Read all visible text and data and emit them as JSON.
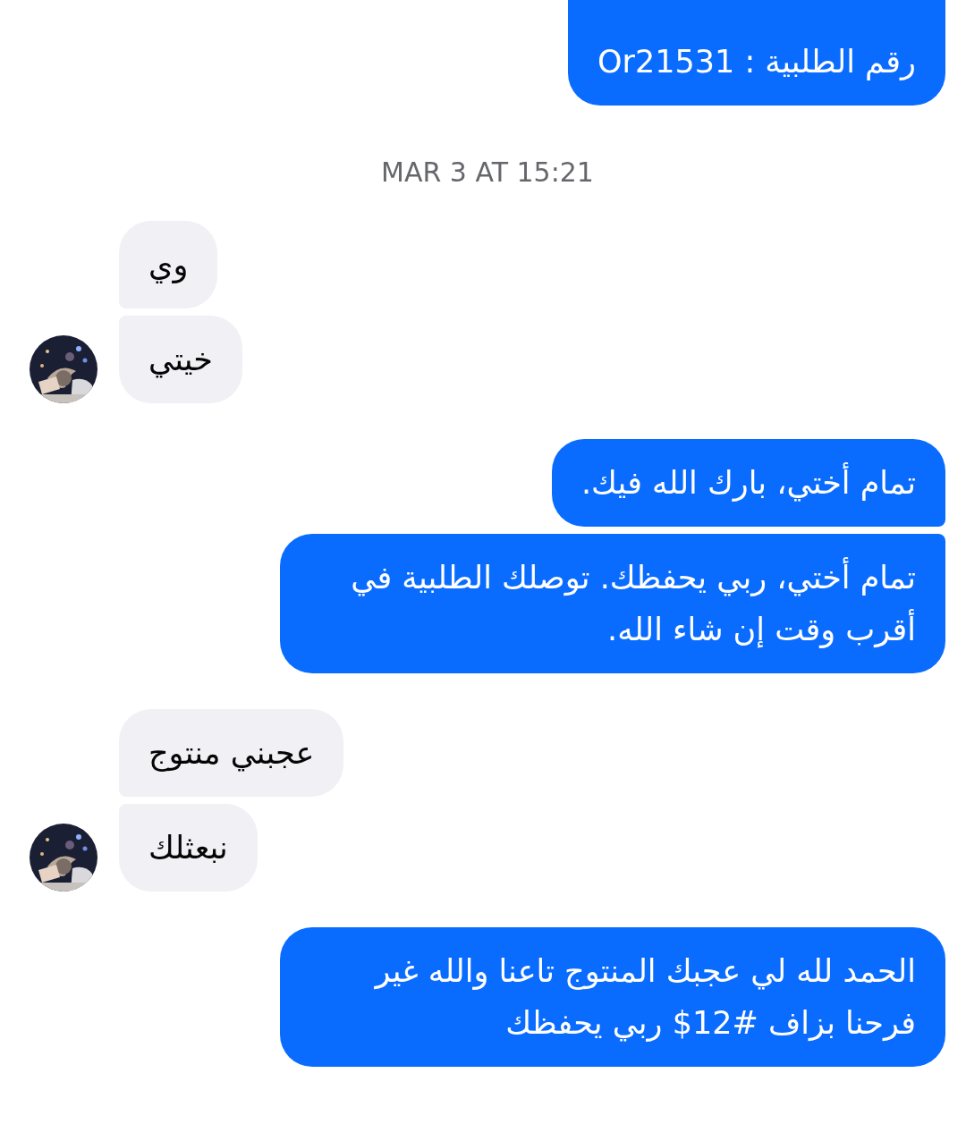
{
  "messages": [
    {
      "kind": "sent",
      "text": "رقم الطلبية : Or21531"
    },
    {
      "kind": "timestamp",
      "text": "MAR 3 AT 15:21"
    },
    {
      "kind": "received",
      "text": "وي",
      "avatar": false
    },
    {
      "kind": "received",
      "text": "خيتي",
      "avatar": true
    },
    {
      "kind": "sent",
      "text": "تمام أختي، بارك الله فيك."
    },
    {
      "kind": "sent",
      "text": "تمام أختي، ربي يحفظك. توصلك الطلبية في أقرب وقت إن شاء الله."
    },
    {
      "kind": "received",
      "text": "عجبني منتوج",
      "avatar": false
    },
    {
      "kind": "received",
      "text": "نبعثلك",
      "avatar": true
    },
    {
      "kind": "sent",
      "text": "الحمد لله لي عجبك المنتوج تاعنا والله غير فرحنا بزاف #12$ ربي يحفظك"
    }
  ]
}
